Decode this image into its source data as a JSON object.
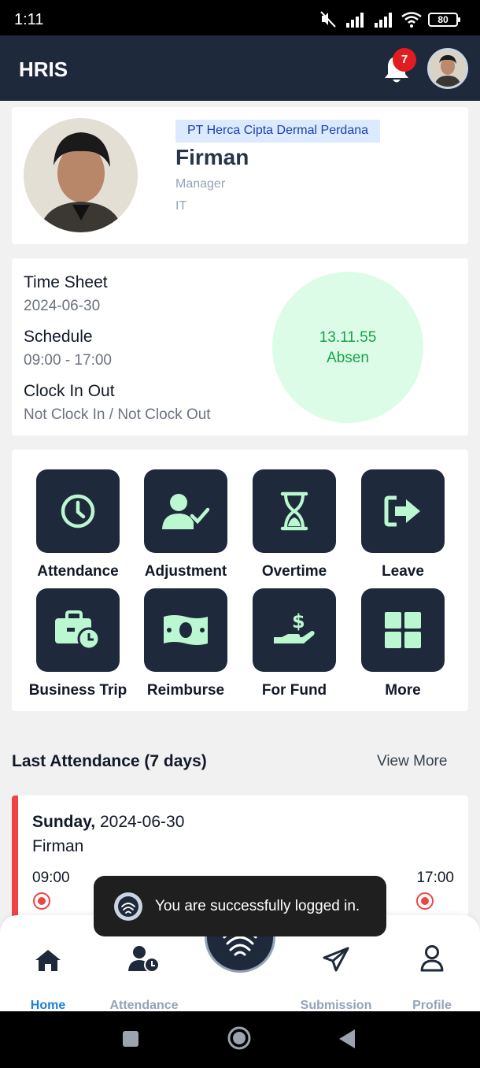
{
  "status_bar": {
    "time": "1:11",
    "battery": "80"
  },
  "app_bar": {
    "title": "HRIS",
    "notification_count": "7"
  },
  "profile": {
    "company": "PT Herca Cipta Dermal Perdana",
    "name": "Firman",
    "position": "Manager",
    "department": "IT"
  },
  "timesheet": {
    "time_sheet_label": "Time Sheet",
    "date": "2024-06-30",
    "schedule_label": "Schedule",
    "schedule": "09:00 - 17:00",
    "clock_label": "Clock In Out",
    "clock_status": "Not Clock In / Not Clock Out",
    "clock_time": "13.11.55",
    "clock_state": "Absen"
  },
  "menu": [
    {
      "label": "Attendance",
      "icon": "clock-icon"
    },
    {
      "label": "Adjustment",
      "icon": "user-check-icon"
    },
    {
      "label": "Overtime",
      "icon": "hourglass-icon"
    },
    {
      "label": "Leave",
      "icon": "exit-icon"
    },
    {
      "label": "Business Trip",
      "icon": "briefcase-clock-icon"
    },
    {
      "label": "Reimburse",
      "icon": "money-icon"
    },
    {
      "label": "For Fund",
      "icon": "hand-dollar-icon"
    },
    {
      "label": "More",
      "icon": "grid-icon"
    }
  ],
  "last_attendance": {
    "title": "Last Attendance (7 days)",
    "view_more": "View More",
    "entries": [
      {
        "day": "Sunday,",
        "date": "2024-06-30",
        "name": "Firman",
        "in": "09:00",
        "out": "17:00"
      }
    ]
  },
  "toast": {
    "message": "You are successfully logged in."
  },
  "bottom_nav": {
    "items": [
      {
        "label": "Home",
        "active": true
      },
      {
        "label": "Attendance",
        "active": false
      },
      {
        "label": "Submission",
        "active": false
      },
      {
        "label": "Profile",
        "active": false
      }
    ]
  },
  "colors": {
    "primary": "#1e293b",
    "accent_icon": "#bbf7d0",
    "active": "#1d7fd6",
    "alert": "#ef4444"
  }
}
